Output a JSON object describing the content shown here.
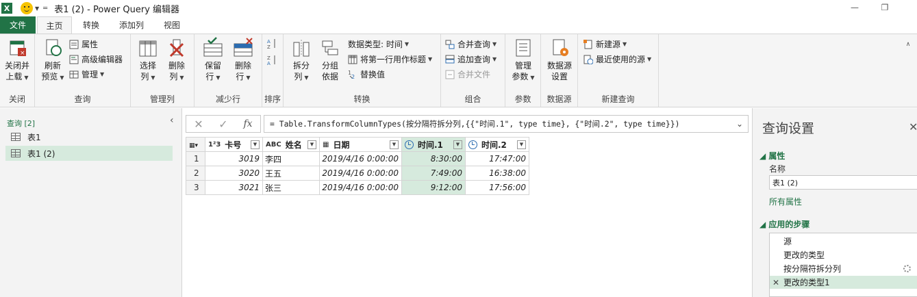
{
  "app": {
    "title": "表1 (2) - Power Query 编辑器",
    "logo": "X"
  },
  "tabs": [
    "文件",
    "主页",
    "转换",
    "添加列",
    "视图"
  ],
  "ribbon": {
    "close": {
      "btn1": "关闭并",
      "btn1b": "上载",
      "label": "关闭"
    },
    "query": {
      "refresh": "刷新",
      "refreshb": "预览",
      "props": "属性",
      "adv": "高级编辑器",
      "manage": "管理",
      "label": "查询"
    },
    "cols": {
      "select": "选择",
      "selectb": "列",
      "remove": "删除",
      "removeb": "列",
      "label": "管理列"
    },
    "rows": {
      "keep": "保留",
      "keepb": "行",
      "remove": "删除",
      "removeb": "行",
      "label": "减少行"
    },
    "sort": {
      "label": "排序"
    },
    "transform": {
      "split": "拆分",
      "splitb": "列",
      "group": "分组",
      "groupb": "依据",
      "dtype": "数据类型: 时间",
      "first_row": "将第一行用作标题",
      "replace": "替换值",
      "label": "转换"
    },
    "combine": {
      "merge": "合并查询",
      "append": "追加查询",
      "files": "合并文件",
      "label": "组合"
    },
    "params": {
      "manage": "管理",
      "manageb": "参数",
      "label": "参数"
    },
    "datasource": {
      "settings": "数据源",
      "settingsb": "设置",
      "label": "数据源"
    },
    "newquery": {
      "newsource": "新建源",
      "recent": "最近使用的源",
      "label": "新建查询"
    }
  },
  "queries": {
    "header": "查询 [2]",
    "items": [
      "表1",
      "表1 (2)"
    ]
  },
  "formula": "= Table.TransformColumnTypes(按分隔符拆分列,{{\"时间.1\", type time}, {\"时间.2\", type time}})",
  "grid": {
    "columns": [
      {
        "type": "1²3",
        "name": "卡号"
      },
      {
        "type": "ABC",
        "name": "姓名"
      },
      {
        "type": "date",
        "name": "日期"
      },
      {
        "type": "time",
        "name": "时间.1"
      },
      {
        "type": "time",
        "name": "时间.2"
      }
    ],
    "rows": [
      [
        "1",
        "3019",
        "李四",
        "2019/4/16 0:00:00",
        "8:30:00",
        "17:47:00"
      ],
      [
        "2",
        "3020",
        "王五",
        "2019/4/16 0:00:00",
        "7:49:00",
        "16:38:00"
      ],
      [
        "3",
        "3021",
        "张三",
        "2019/4/16 0:00:00",
        "9:12:00",
        "17:56:00"
      ]
    ]
  },
  "settings": {
    "title": "查询设置",
    "props_header": "属性",
    "name_label": "名称",
    "name_value": "表1 (2)",
    "all_props": "所有属性",
    "steps_header": "应用的步骤",
    "steps": [
      "源",
      "更改的类型",
      "按分隔符拆分列",
      "更改的类型1"
    ]
  },
  "colors": {
    "accent": "#217346",
    "highlight": "#d6eadd"
  }
}
